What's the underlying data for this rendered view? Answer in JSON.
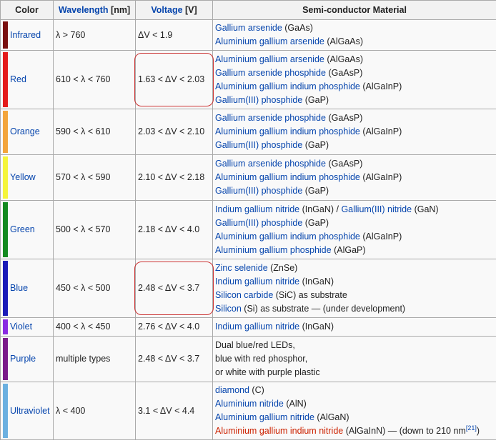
{
  "headers": {
    "color": "Color",
    "wavelength_link": "Wavelength",
    "wavelength_unit": " [nm]",
    "voltage_link": "Voltage",
    "voltage_unit": " [V]",
    "material": "Semi-conductor Material"
  },
  "rows": [
    {
      "color": "Infrared",
      "swatch": "#7a1010",
      "wavelength": "λ > 760",
      "voltage": "ΔV < 1.9",
      "highlight": false,
      "materials": [
        {
          "link": "Gallium arsenide",
          "text": " (GaAs)"
        },
        {
          "link": "Aluminium gallium arsenide",
          "text": " (AlGaAs)"
        }
      ]
    },
    {
      "color": "Red",
      "swatch": "#e41b1b",
      "wavelength": "610 < λ < 760",
      "voltage": "1.63 < ΔV < 2.03",
      "highlight": true,
      "materials": [
        {
          "link": "Aluminium gallium arsenide",
          "text": " (AlGaAs)"
        },
        {
          "link": "Gallium arsenide phosphide",
          "text": " (GaAsP)"
        },
        {
          "link": "Aluminium gallium indium phosphide",
          "text": " (AlGaInP)"
        },
        {
          "link": "Gallium(III) phosphide",
          "text": " (GaP)"
        }
      ]
    },
    {
      "color": "Orange",
      "swatch": "#f3a53b",
      "wavelength": "590 < λ < 610",
      "voltage": "2.03 < ΔV < 2.10",
      "highlight": false,
      "materials": [
        {
          "link": "Gallium arsenide phosphide",
          "text": " (GaAsP)"
        },
        {
          "link": "Aluminium gallium indium phosphide",
          "text": " (AlGaInP)"
        },
        {
          "link": "Gallium(III) phosphide",
          "text": " (GaP)"
        }
      ]
    },
    {
      "color": "Yellow",
      "swatch": "#f5f53a",
      "wavelength": "570 < λ < 590",
      "voltage": "2.10 < ΔV < 2.18",
      "highlight": false,
      "materials": [
        {
          "link": "Gallium arsenide phosphide",
          "text": " (GaAsP)"
        },
        {
          "link": "Aluminium gallium indium phosphide",
          "text": " (AlGaInP)"
        },
        {
          "link": "Gallium(III) phosphide",
          "text": " (GaP)"
        }
      ]
    },
    {
      "color": "Green",
      "swatch": "#138a1f",
      "wavelength": "500 < λ < 570",
      "voltage": "2.18 < ΔV < 4.0",
      "highlight": false,
      "materials": [
        {
          "link": "Indium gallium nitride",
          "text": " (InGaN) / ",
          "link2": "Gallium(III) nitride",
          "text2": " (GaN)"
        },
        {
          "link": "Gallium(III) phosphide",
          "text": " (GaP)"
        },
        {
          "link": "Aluminium gallium indium phosphide",
          "text": " (AlGaInP)"
        },
        {
          "link": "Aluminium gallium phosphide",
          "text": " (AlGaP)"
        }
      ]
    },
    {
      "color": "Blue",
      "swatch": "#1a1ab8",
      "wavelength": "450 < λ < 500",
      "voltage": "2.48 < ΔV < 3.7",
      "highlight": true,
      "materials": [
        {
          "link": "Zinc selenide",
          "text": " (ZnSe)"
        },
        {
          "link": "Indium gallium nitride",
          "text": " (InGaN)"
        },
        {
          "link": "Silicon carbide",
          "text": " (SiC) as substrate"
        },
        {
          "link": "Silicon",
          "text": " (Si) as substrate — (under development)"
        }
      ]
    },
    {
      "color": "Violet",
      "swatch": "#8a2be2",
      "wavelength": "400 < λ < 450",
      "voltage": "2.76 < ΔV < 4.0",
      "highlight": false,
      "materials": [
        {
          "link": "Indium gallium nitride",
          "text": " (InGaN)"
        }
      ]
    },
    {
      "color": "Purple",
      "swatch": "#7b1a8a",
      "wavelength": "multiple types",
      "voltage": "2.48 < ΔV < 3.7",
      "highlight": false,
      "materials": [
        {
          "link": "",
          "text": "Dual blue/red LEDs,"
        },
        {
          "link": "",
          "text": "blue with red phosphor,"
        },
        {
          "link": "",
          "text": "or white with purple plastic"
        }
      ]
    },
    {
      "color": "Ultraviolet",
      "swatch": "#6bb0e0",
      "wavelength": "λ < 400",
      "voltage": "3.1 < ΔV < 4.4",
      "highlight": false,
      "materials": [
        {
          "link": "diamond",
          "text": " (C)"
        },
        {
          "link": "Aluminium nitride",
          "text": " (AlN)"
        },
        {
          "link": "Aluminium gallium nitride",
          "text": " (AlGaN)"
        },
        {
          "link": "Aluminium gallium indium nitride",
          "text": " (AlGaInN) — (down to 210 nm",
          "ref": "[21]",
          "close": ")",
          "new_link": true
        }
      ]
    }
  ]
}
